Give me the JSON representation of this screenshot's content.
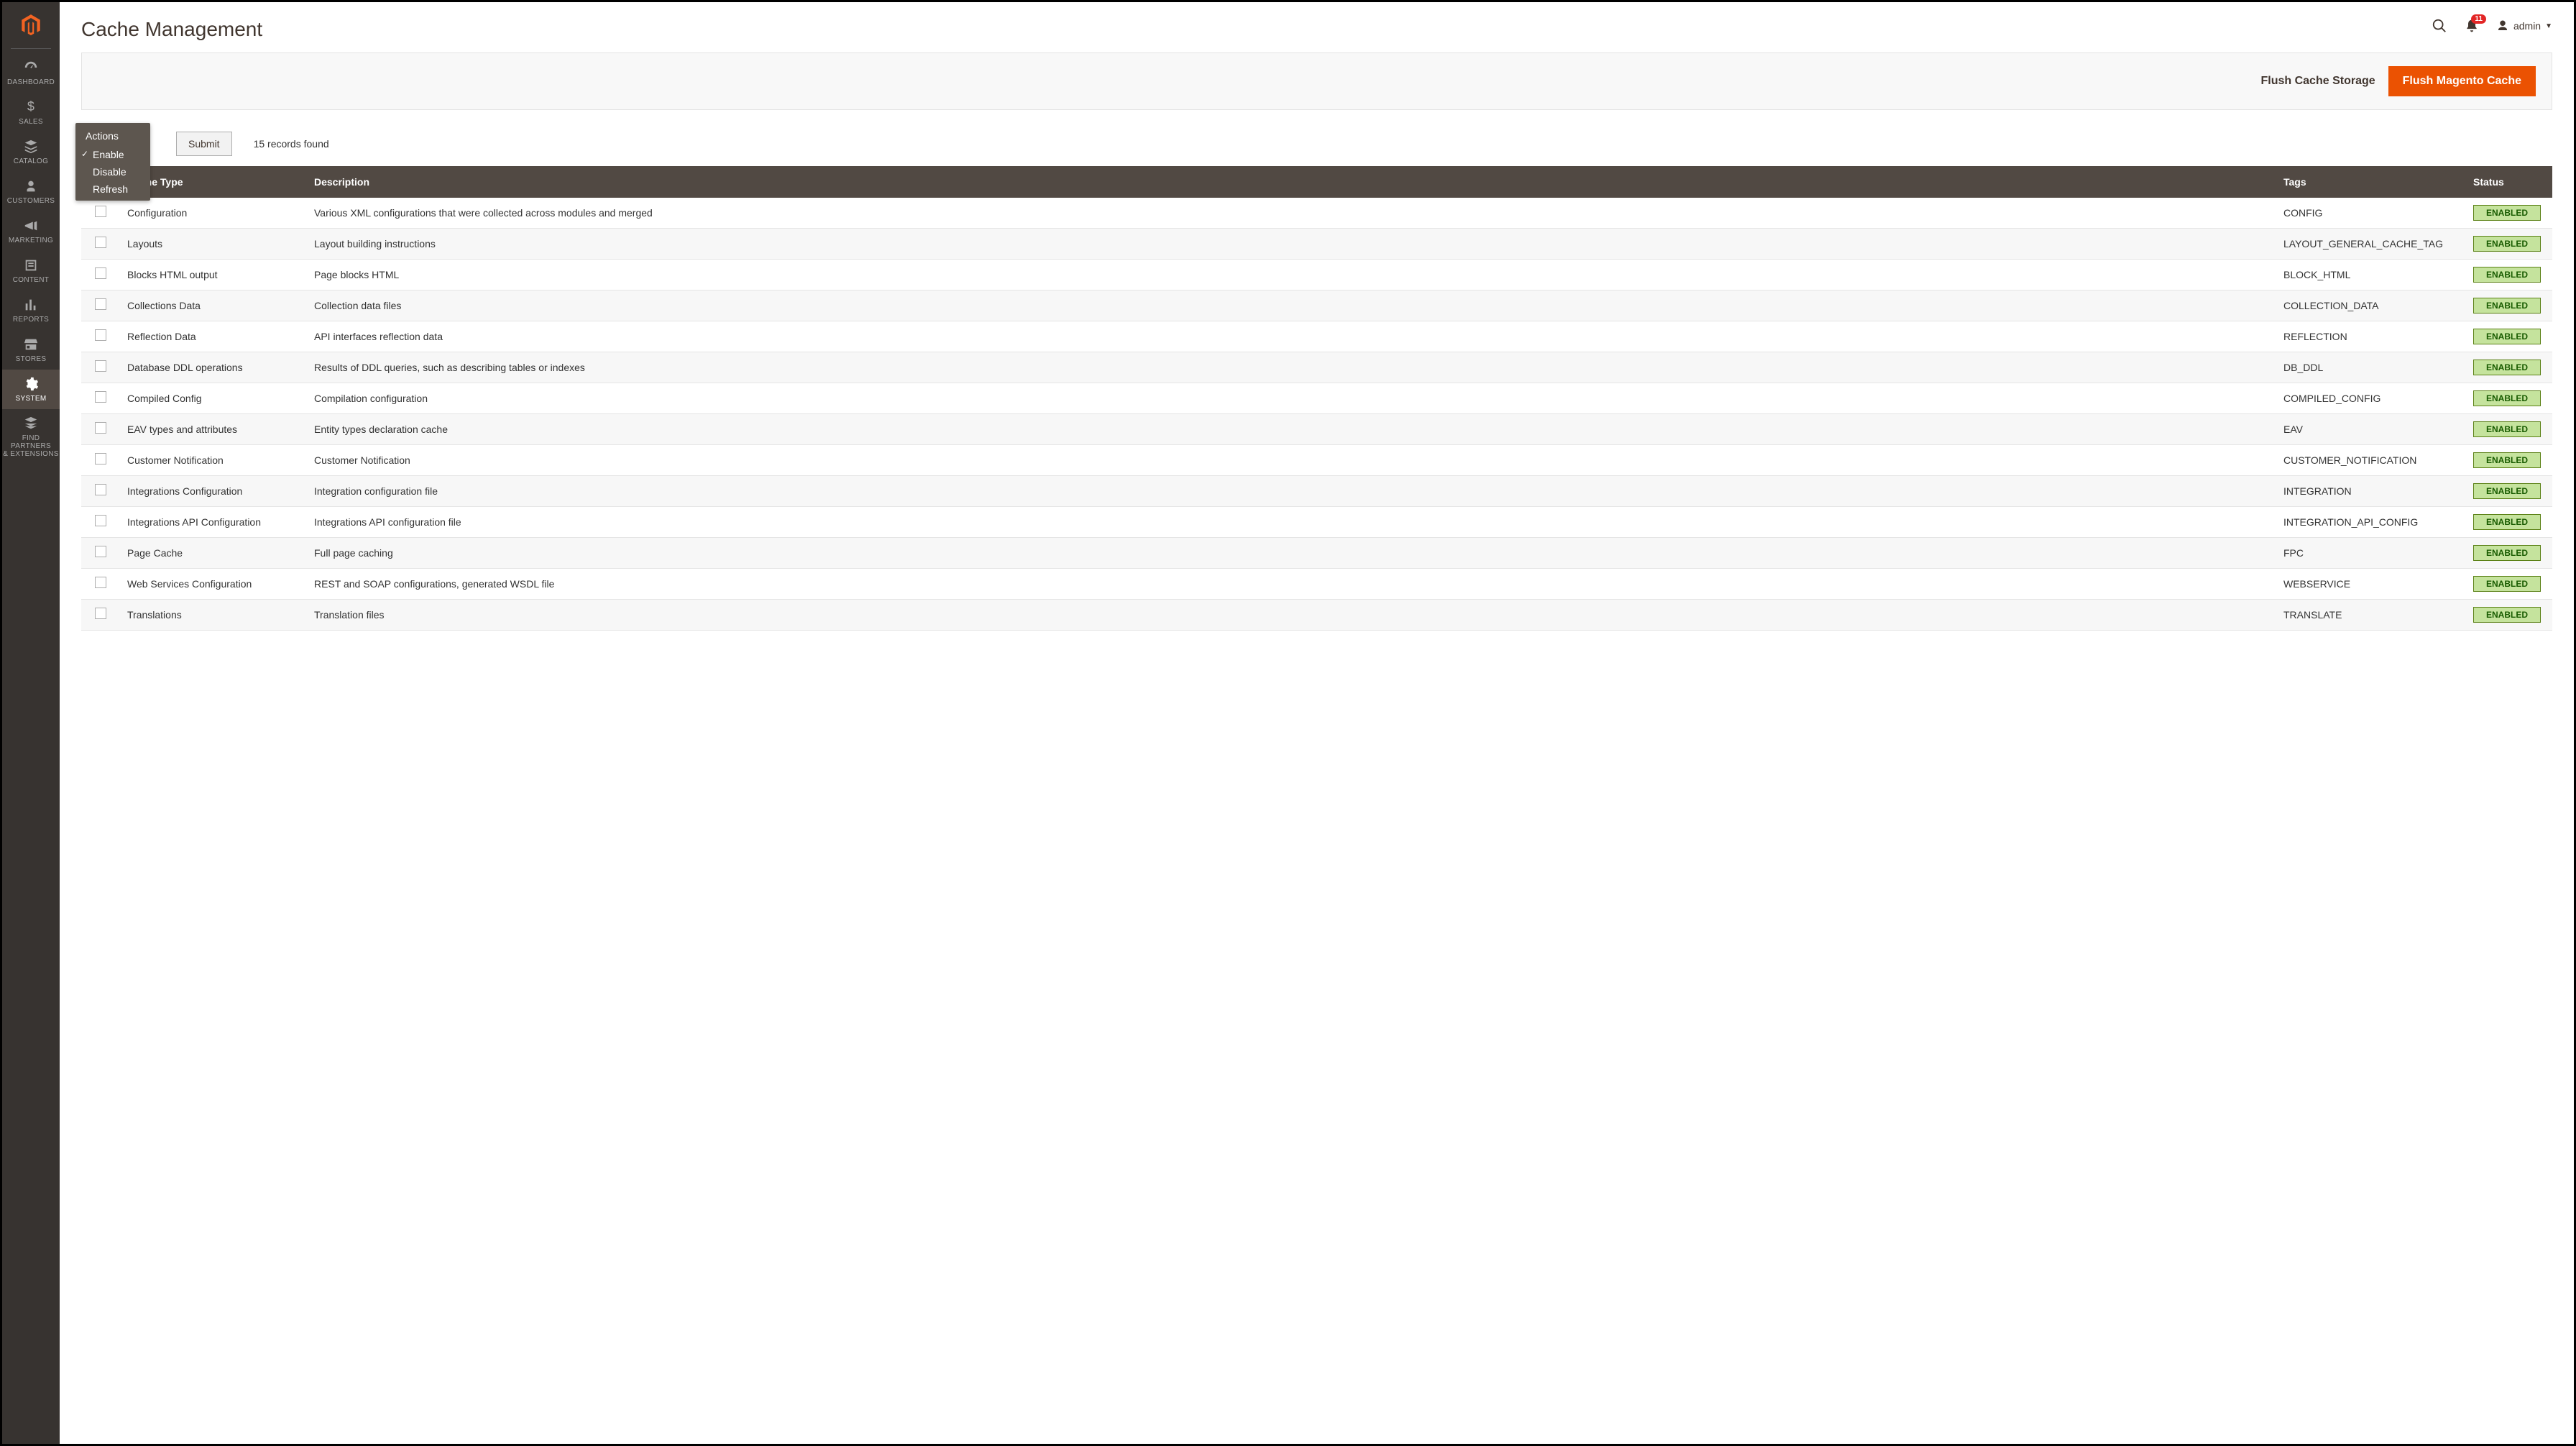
{
  "page": {
    "title": "Cache Management"
  },
  "header": {
    "notification_count": "11",
    "user_label": "admin"
  },
  "sidebar": {
    "items": [
      {
        "label": "DASHBOARD",
        "icon": "dashboard"
      },
      {
        "label": "SALES",
        "icon": "dollar"
      },
      {
        "label": "CATALOG",
        "icon": "catalog"
      },
      {
        "label": "CUSTOMERS",
        "icon": "customers"
      },
      {
        "label": "MARKETING",
        "icon": "marketing"
      },
      {
        "label": "CONTENT",
        "icon": "content"
      },
      {
        "label": "REPORTS",
        "icon": "reports"
      },
      {
        "label": "STORES",
        "icon": "stores"
      },
      {
        "label": "SYSTEM",
        "icon": "system",
        "active": true
      },
      {
        "label": "FIND PARTNERS\n& EXTENSIONS",
        "icon": "partners"
      }
    ]
  },
  "buttons": {
    "flush_storage": "Flush Cache Storage",
    "flush_magento": "Flush Magento Cache",
    "submit": "Submit"
  },
  "actions_menu": {
    "title": "Actions",
    "items": [
      {
        "label": "Enable",
        "checked": true
      },
      {
        "label": "Disable",
        "checked": false
      },
      {
        "label": "Refresh",
        "checked": false
      }
    ]
  },
  "records_found": "15 records found",
  "table": {
    "headers": {
      "select": "",
      "type": "Cache Type",
      "description": "Description",
      "tags": "Tags",
      "status": "Status"
    },
    "rows": [
      {
        "type": "Configuration",
        "description": "Various XML configurations that were collected across modules and merged",
        "tags": "CONFIG",
        "status": "ENABLED"
      },
      {
        "type": "Layouts",
        "description": "Layout building instructions",
        "tags": "LAYOUT_GENERAL_CACHE_TAG",
        "status": "ENABLED"
      },
      {
        "type": "Blocks HTML output",
        "description": "Page blocks HTML",
        "tags": "BLOCK_HTML",
        "status": "ENABLED"
      },
      {
        "type": "Collections Data",
        "description": "Collection data files",
        "tags": "COLLECTION_DATA",
        "status": "ENABLED"
      },
      {
        "type": "Reflection Data",
        "description": "API interfaces reflection data",
        "tags": "REFLECTION",
        "status": "ENABLED"
      },
      {
        "type": "Database DDL operations",
        "description": "Results of DDL queries, such as describing tables or indexes",
        "tags": "DB_DDL",
        "status": "ENABLED"
      },
      {
        "type": "Compiled Config",
        "description": "Compilation configuration",
        "tags": "COMPILED_CONFIG",
        "status": "ENABLED"
      },
      {
        "type": "EAV types and attributes",
        "description": "Entity types declaration cache",
        "tags": "EAV",
        "status": "ENABLED"
      },
      {
        "type": "Customer Notification",
        "description": "Customer Notification",
        "tags": "CUSTOMER_NOTIFICATION",
        "status": "ENABLED"
      },
      {
        "type": "Integrations Configuration",
        "description": "Integration configuration file",
        "tags": "INTEGRATION",
        "status": "ENABLED"
      },
      {
        "type": "Integrations API Configuration",
        "description": "Integrations API configuration file",
        "tags": "INTEGRATION_API_CONFIG",
        "status": "ENABLED"
      },
      {
        "type": "Page Cache",
        "description": "Full page caching",
        "tags": "FPC",
        "status": "ENABLED"
      },
      {
        "type": "Web Services Configuration",
        "description": "REST and SOAP configurations, generated WSDL file",
        "tags": "WEBSERVICE",
        "status": "ENABLED"
      },
      {
        "type": "Translations",
        "description": "Translation files",
        "tags": "TRANSLATE",
        "status": "ENABLED"
      }
    ]
  }
}
